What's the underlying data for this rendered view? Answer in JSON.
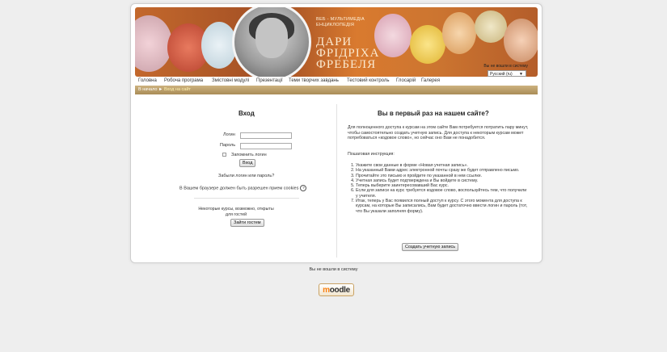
{
  "banner": {
    "subtitle_line1": "ВЕБ - МУЛЬТИМЕДІА",
    "subtitle_line2": "ЕНЦИКЛОПЕДІЯ",
    "title_line1": "ДАРИ",
    "title_line2": "ФРІДРІХА",
    "title_line3": "ФРЕБЕЛЯ",
    "login_info": "Вы не вошли в систему",
    "language": "Русский (ru)"
  },
  "nav": {
    "items": [
      "Головна",
      "Робоча програма",
      "Змістовні модулі",
      "Презентації",
      "Теми творчих завдань",
      "Тестовий контроль",
      "Глосарій",
      "Галерея"
    ]
  },
  "breadcrumb": {
    "home": "В начало",
    "separator": "►",
    "current": "Вход на сайт"
  },
  "login": {
    "title": "Вход",
    "username_label": "Логин",
    "password_label": "Пароль",
    "remember_label": "Запомнить логин",
    "submit_label": "Вход",
    "forgot_link": "Забыли логин или пароль?",
    "cookies_note": "В Вашем браузере должен быть разрешен прием cookies",
    "help_icon": "?",
    "guest_note": "Некоторые курсы, возможно, открыты для гостей",
    "guest_button": "Зайти гостем"
  },
  "signup": {
    "title": "Вы в первый раз на нашем сайте?",
    "intro": "Для полноценного доступа к курсам на этом сайте Вам потребуется потратить пару минут, чтобы самостоятельно создать учетную запись. Для доступа к некоторым курсам может потребоваться «кодовое слово», но сейчас оно Вам не понадобится.",
    "steps_title": "Пошаговая инструкция:",
    "steps": [
      "Укажите свои данные в форме «Новая учетная запись».",
      "На указанный Вами адрес электронной почты сразу же будет отправлено письмо.",
      "Прочитайте это письмо и пройдите по указанной в нем ссылке.",
      "Учетная запись будет подтверждена и Вы войдете в систему.",
      "Теперь выберите заинтересовавший Вас курс.",
      "Если для записи на курс требуется кодовое слово, воспользуйтесь тем, что получили у учителя.",
      "Итак, теперь у Вас появился полный доступ к курсу. С этого момента для доступа к курсам, на которые Вы записались, Вам будет достаточно ввести логин и пароль (тот, что Вы указали заполняя форму)."
    ],
    "create_button": "Создать учетную запись"
  },
  "footer": {
    "login_info": "Вы не вошли в систему",
    "logo_text_m": "m",
    "logo_text_rest": "oodle"
  },
  "colors": {
    "banner_orange": "#c3682c",
    "breadcrumb_tan": "#a98c57",
    "moodle_orange": "#f98012"
  }
}
